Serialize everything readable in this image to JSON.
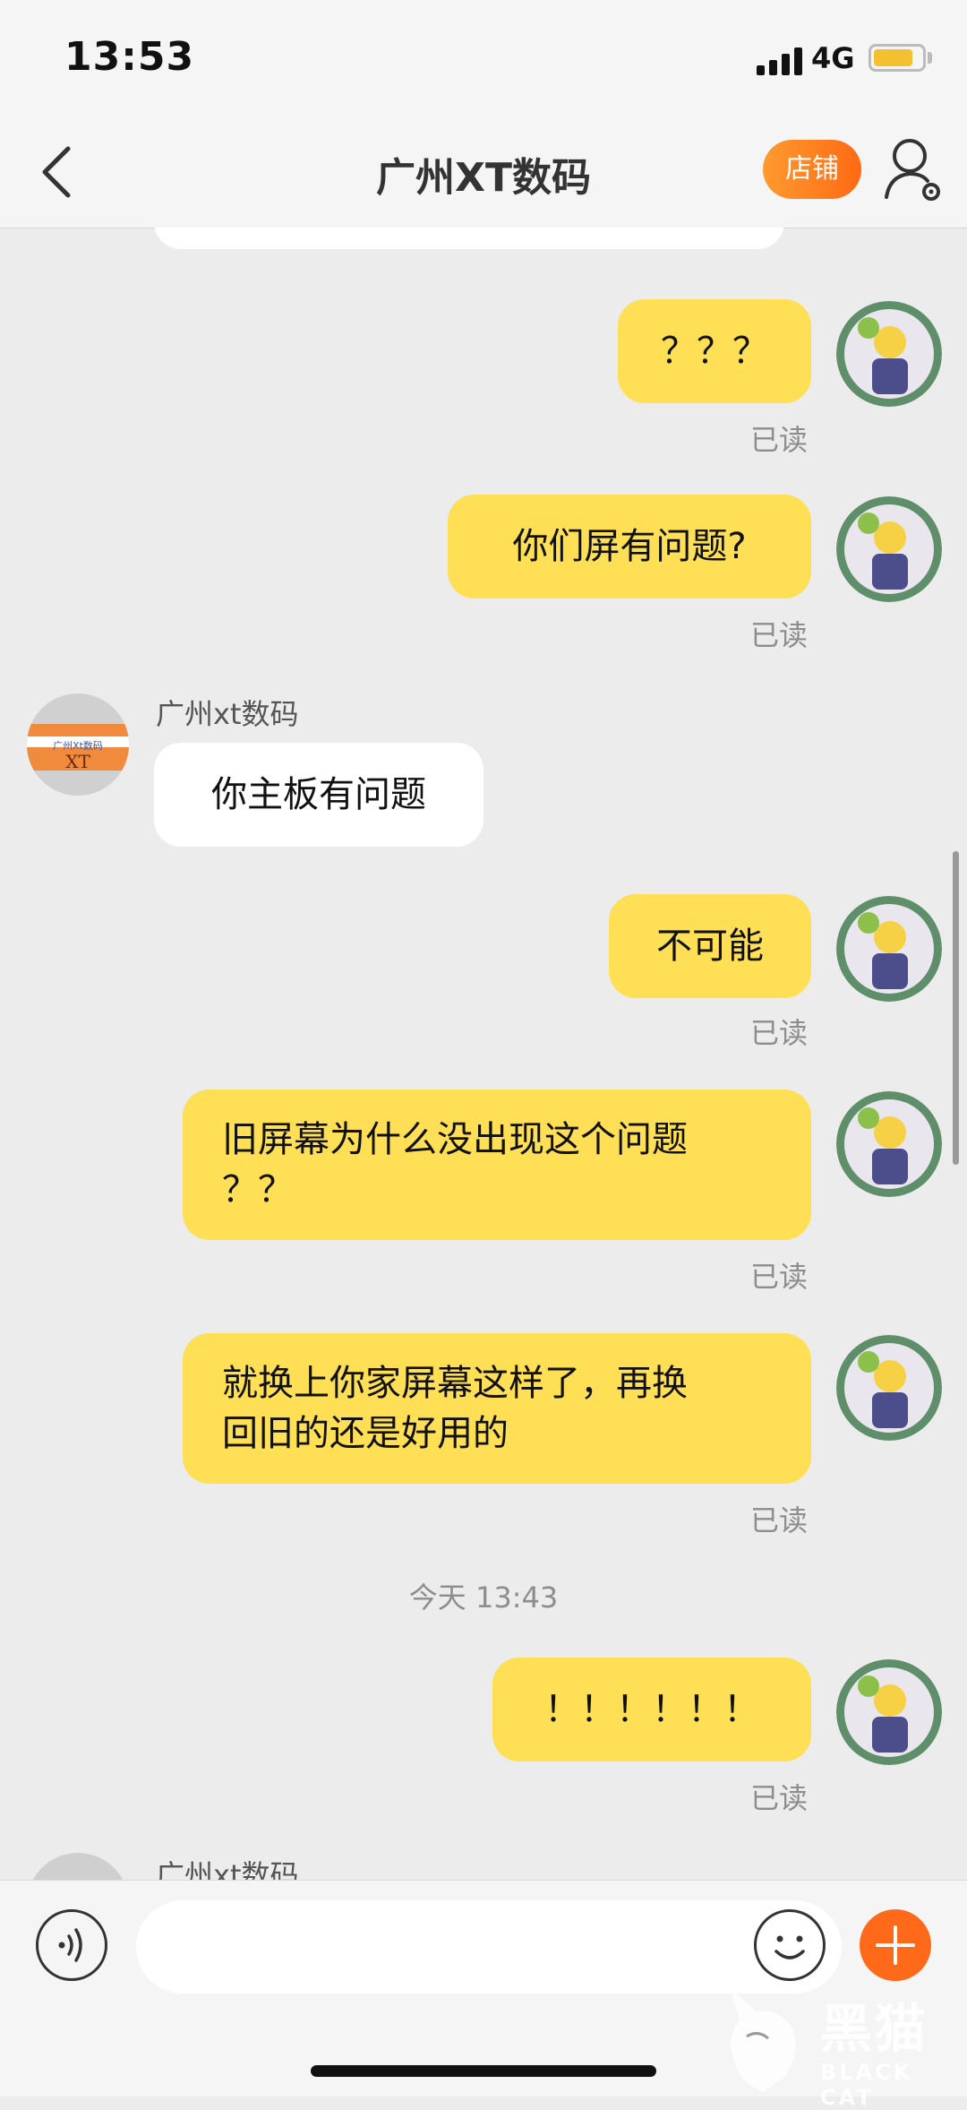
{
  "status_bar": {
    "time": "13:53",
    "network": "4G",
    "battery_level": 0.75,
    "battery_color": "#f3c130"
  },
  "header": {
    "title": "广州XT数码",
    "shop_label": "店铺",
    "back_icon": "chevron-left-icon",
    "profile_icon": "user-settings-icon"
  },
  "messages": [
    {
      "side": "me",
      "text": "？？？",
      "status": "已读"
    },
    {
      "side": "me",
      "text": "你们屏有问题?",
      "status": "已读"
    },
    {
      "side": "them",
      "sender": "广州xt数码",
      "text": "你主板有问题"
    },
    {
      "side": "me",
      "text": "不可能",
      "status": "已读"
    },
    {
      "side": "me",
      "lines": [
        "旧屏幕为什么没出现这个问题",
        "？？"
      ],
      "status": "已读"
    },
    {
      "side": "me",
      "lines": [
        "就换上你家屏幕这样了，再换",
        "回旧的还是好用的"
      ],
      "status": "已读"
    },
    {
      "side": "me",
      "text": "！！！！！！",
      "status": "已读"
    },
    {
      "side": "them",
      "sender": "广州xt数码"
    }
  ],
  "time_separator": "今天 13:43",
  "shop_avatar_text": {
    "top": "广州Xt数码",
    "bottom": "XT"
  },
  "input_bar": {
    "placeholder": "",
    "voice_icon": "voice-icon",
    "emoji_icon": "emoji-icon",
    "plus_icon": "plus-icon"
  },
  "watermark": {
    "text_cn": "黑猫",
    "text_en": "BLACK CAT"
  },
  "colors": {
    "my_bubble": "#fedf55",
    "their_bubble": "#ffffff",
    "accent": "#ff6a14",
    "background": "#ececec"
  }
}
